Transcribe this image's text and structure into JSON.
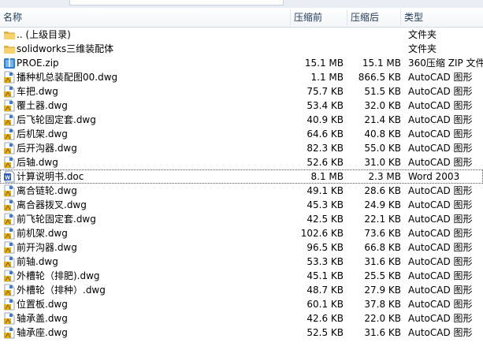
{
  "header": {
    "name": "名称",
    "compressed": "压缩前",
    "after": "压缩后",
    "type": "类型"
  },
  "files": [
    {
      "name": ".. (上级目录)",
      "before": "",
      "after": "",
      "type": "文件夹",
      "icon": "folder-icon"
    },
    {
      "name": "solidworks三维装配体",
      "before": "",
      "after": "",
      "type": "文件夹",
      "icon": "folder-icon"
    },
    {
      "name": "PROE.zip",
      "before": "15.1 MB",
      "after": "15.1 MB",
      "type": "360压缩 ZIP 文件",
      "icon": "zip-icon"
    },
    {
      "name": "播种机总装配图00.dwg",
      "before": "1.1 MB",
      "after": "866.5 KB",
      "type": "AutoCAD 图形",
      "icon": "dwg-icon"
    },
    {
      "name": "车把.dwg",
      "before": "75.7 KB",
      "after": "51.5 KB",
      "type": "AutoCAD 图形",
      "icon": "dwg-icon"
    },
    {
      "name": "覆土器.dwg",
      "before": "53.4 KB",
      "after": "32.0 KB",
      "type": "AutoCAD 图形",
      "icon": "dwg-icon"
    },
    {
      "name": "后飞轮固定套.dwg",
      "before": "40.9 KB",
      "after": "21.4 KB",
      "type": "AutoCAD 图形",
      "icon": "dwg-icon"
    },
    {
      "name": "后机架.dwg",
      "before": "64.6 KB",
      "after": "40.8 KB",
      "type": "AutoCAD 图形",
      "icon": "dwg-icon"
    },
    {
      "name": "后开沟器.dwg",
      "before": "82.3 KB",
      "after": "55.0 KB",
      "type": "AutoCAD 图形",
      "icon": "dwg-icon"
    },
    {
      "name": "后轴.dwg",
      "before": "52.6 KB",
      "after": "31.0 KB",
      "type": "AutoCAD 图形",
      "icon": "dwg-icon"
    },
    {
      "name": "计算说明书.doc",
      "before": "8.1 MB",
      "after": "2.3 MB",
      "type": "Word 2003",
      "icon": "word-icon",
      "selected": true
    },
    {
      "name": "离合链轮.dwg",
      "before": "49.1 KB",
      "after": "28.6 KB",
      "type": "AutoCAD 图形",
      "icon": "dwg-icon"
    },
    {
      "name": "离合器拨叉.dwg",
      "before": "45.3 KB",
      "after": "24.9 KB",
      "type": "AutoCAD 图形",
      "icon": "dwg-icon"
    },
    {
      "name": "前飞轮固定套.dwg",
      "before": "42.5 KB",
      "after": "22.1 KB",
      "type": "AutoCAD 图形",
      "icon": "dwg-icon"
    },
    {
      "name": "前机架.dwg",
      "before": "102.6 KB",
      "after": "73.6 KB",
      "type": "AutoCAD 图形",
      "icon": "dwg-icon"
    },
    {
      "name": "前开沟器.dwg",
      "before": "96.5 KB",
      "after": "66.8 KB",
      "type": "AutoCAD 图形",
      "icon": "dwg-icon"
    },
    {
      "name": "前轴.dwg",
      "before": "53.3 KB",
      "after": "31.6 KB",
      "type": "AutoCAD 图形",
      "icon": "dwg-icon"
    },
    {
      "name": "外槽轮（排肥).dwg",
      "before": "45.1 KB",
      "after": "25.5 KB",
      "type": "AutoCAD 图形",
      "icon": "dwg-icon"
    },
    {
      "name": "外槽轮（排种）.dwg",
      "before": "48.7 KB",
      "after": "27.9 KB",
      "type": "AutoCAD 图形",
      "icon": "dwg-icon"
    },
    {
      "name": "位置板.dwg",
      "before": "60.1 KB",
      "after": "37.8 KB",
      "type": "AutoCAD 图形",
      "icon": "dwg-icon"
    },
    {
      "name": "轴承盖.dwg",
      "before": "42.6 KB",
      "after": "22.0 KB",
      "type": "AutoCAD 图形",
      "icon": "dwg-icon"
    },
    {
      "name": "轴承座.dwg",
      "before": "52.5 KB",
      "after": "31.6 KB",
      "type": "AutoCAD 图形",
      "icon": "dwg-icon"
    }
  ]
}
